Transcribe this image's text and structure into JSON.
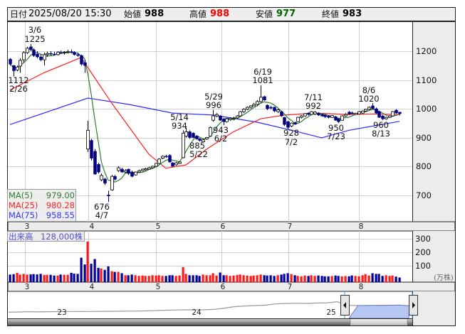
{
  "header": {
    "date_label": "日付",
    "date_value": "2025/08/20 15:30",
    "open_label": "始値",
    "open_value": "988",
    "high_label": "高値",
    "high_value": "988",
    "low_label": "安値",
    "low_value": "977",
    "close_label": "終値",
    "close_value": "983"
  },
  "colors": {
    "up_volume": "#ff1a1a",
    "down_volume": "#000099",
    "down_candle": "#000080",
    "ma5": "#2e7d2e",
    "ma25": "#ff2020",
    "ma75": "#2a2aff",
    "high": "#ff0000",
    "low": "#006600"
  },
  "legend": [
    {
      "name": "MA(5)",
      "value": "979.00"
    },
    {
      "name": "MA(25)",
      "value": "980.28"
    },
    {
      "name": "MA(75)",
      "value": "958.55"
    }
  ],
  "volume_label": {
    "name": "出来高",
    "value": "128,000株"
  },
  "months": [
    "3",
    "4",
    "5",
    "6",
    "7",
    "8"
  ],
  "price_ticks": [
    "1200",
    "1100",
    "1000",
    "900",
    "800",
    "700"
  ],
  "volume_ticks": [
    "300",
    "200",
    "100"
  ],
  "volume_unit": "(万株)",
  "annotations": [
    {
      "date": "3/6",
      "price": "1225"
    },
    {
      "date": "2/26",
      "price": "1112"
    },
    {
      "date": "4/7",
      "price": "676"
    },
    {
      "date": "5/14",
      "price": "934"
    },
    {
      "date": "5/22",
      "price": "885"
    },
    {
      "date": "5/29",
      "price": "996"
    },
    {
      "date": "6/2",
      "price": "943"
    },
    {
      "date": "6/19",
      "price": "1081"
    },
    {
      "date": "7/2",
      "price": "928"
    },
    {
      "date": "7/11",
      "price": "992"
    },
    {
      "date": "7/23",
      "price": "950"
    },
    {
      "date": "8/6",
      "price": "1020"
    },
    {
      "date": "8/13",
      "price": "960"
    }
  ],
  "navigator": {
    "year_labels": [
      "23",
      "24",
      "25"
    ],
    "series": [
      690,
      700,
      710,
      705,
      715,
      720,
      725,
      720,
      725,
      730,
      730,
      735,
      740,
      745,
      760,
      780,
      790,
      800,
      800,
      805,
      820,
      880,
      950,
      980,
      1000,
      1020,
      1080,
      1100,
      1110,
      1100,
      1120,
      1130,
      1180,
      1010,
      1000,
      1005,
      1010,
      1015,
      1020,
      990
    ],
    "selected_range": [
      "2025/02/26",
      "2025/08/20"
    ]
  },
  "chart_data": {
    "type": "candlestick",
    "title": "",
    "date_range": [
      "2025/02/26",
      "2025/08/20"
    ],
    "ylabel": "",
    "ylim": [
      640,
      1290
    ],
    "volume_unit": "万株",
    "volume_ylim": [
      0,
      310
    ],
    "candles_ohlc": [
      [
        1172,
        1176,
        1150,
        1155
      ],
      [
        1150,
        1152,
        1112,
        1132
      ],
      [
        1135,
        1150,
        1130,
        1145
      ],
      [
        1148,
        1175,
        1125,
        1168
      ],
      [
        1170,
        1200,
        1160,
        1195
      ],
      [
        1195,
        1215,
        1190,
        1210
      ],
      [
        1215,
        1225,
        1200,
        1205
      ],
      [
        1205,
        1210,
        1180,
        1185
      ],
      [
        1190,
        1200,
        1175,
        1180
      ],
      [
        1180,
        1190,
        1165,
        1170
      ],
      [
        1170,
        1195,
        1150,
        1188
      ],
      [
        1188,
        1198,
        1180,
        1192
      ],
      [
        1192,
        1200,
        1185,
        1190
      ],
      [
        1190,
        1198,
        1185,
        1188
      ],
      [
        1188,
        1200,
        1185,
        1196
      ],
      [
        1196,
        1202,
        1190,
        1195
      ],
      [
        1195,
        1200,
        1188,
        1197
      ],
      [
        1197,
        1205,
        1192,
        1198
      ],
      [
        1198,
        1206,
        1192,
        1196
      ],
      [
        1196,
        1200,
        1185,
        1188
      ],
      [
        1188,
        1195,
        1180,
        1185
      ],
      [
        1185,
        1188,
        1150,
        1155
      ],
      [
        1160,
        1170,
        1125,
        1150
      ],
      [
        860,
        958,
        850,
        925
      ],
      [
        890,
        895,
        820,
        828
      ],
      [
        852,
        860,
        770,
        773
      ],
      [
        807,
        812,
        775,
        780
      ],
      [
        753,
        775,
        748,
        768
      ],
      [
        756,
        760,
        735,
        741
      ],
      [
        700,
        715,
        676,
        697
      ],
      [
        718,
        770,
        715,
        765
      ],
      [
        765,
        770,
        750,
        755
      ],
      [
        785,
        800,
        780,
        795
      ],
      [
        790,
        795,
        778,
        780
      ],
      [
        780,
        790,
        776,
        785
      ],
      [
        790,
        792,
        770,
        775
      ],
      [
        780,
        785,
        762,
        765
      ],
      [
        770,
        782,
        768,
        780
      ],
      [
        780,
        788,
        778,
        785
      ],
      [
        785,
        792,
        782,
        790
      ],
      [
        788,
        795,
        785,
        792
      ],
      [
        790,
        798,
        788,
        795
      ],
      [
        795,
        802,
        792,
        800
      ],
      [
        800,
        812,
        798,
        810
      ],
      [
        810,
        828,
        808,
        825
      ],
      [
        828,
        838,
        825,
        835
      ],
      [
        835,
        840,
        830,
        833
      ],
      [
        838,
        842,
        812,
        815
      ],
      [
        812,
        815,
        798,
        800
      ],
      [
        805,
        815,
        802,
        812
      ],
      [
        810,
        818,
        808,
        815
      ],
      [
        830,
        925,
        828,
        915
      ],
      [
        905,
        934,
        900,
        920
      ],
      [
        920,
        925,
        895,
        900
      ],
      [
        915,
        918,
        898,
        900
      ],
      [
        905,
        908,
        892,
        895
      ],
      [
        895,
        898,
        886,
        890
      ],
      [
        885,
        895,
        885,
        892
      ],
      [
        895,
        902,
        892,
        900
      ],
      [
        905,
        938,
        903,
        935
      ],
      [
        960,
        996,
        955,
        975
      ],
      [
        975,
        985,
        970,
        980
      ],
      [
        975,
        978,
        958,
        960
      ],
      [
        965,
        968,
        943,
        955
      ],
      [
        955,
        968,
        952,
        965
      ],
      [
        962,
        970,
        958,
        966
      ],
      [
        966,
        972,
        960,
        968
      ],
      [
        968,
        978,
        965,
        975
      ],
      [
        975,
        992,
        972,
        990
      ],
      [
        990,
        1002,
        985,
        998
      ],
      [
        998,
        1008,
        995,
        1005
      ],
      [
        1005,
        1012,
        1000,
        1010
      ],
      [
        1010,
        1020,
        1008,
        1015
      ],
      [
        1015,
        1030,
        1010,
        1025
      ],
      [
        1025,
        1081,
        1020,
        1040
      ],
      [
        1042,
        1045,
        1028,
        1030
      ],
      [
        1012,
        1015,
        995,
        1000
      ],
      [
        1005,
        1010,
        998,
        1002
      ],
      [
        1005,
        1008,
        988,
        992
      ],
      [
        990,
        1000,
        985,
        996
      ],
      [
        990,
        993,
        972,
        975
      ],
      [
        970,
        972,
        940,
        945
      ],
      [
        955,
        958,
        928,
        935
      ],
      [
        940,
        952,
        936,
        950
      ],
      [
        952,
        955,
        944,
        946
      ],
      [
        955,
        972,
        953,
        970
      ],
      [
        970,
        978,
        966,
        975
      ],
      [
        975,
        985,
        972,
        983
      ],
      [
        985,
        988,
        976,
        980
      ],
      [
        980,
        992,
        978,
        990
      ],
      [
        982,
        992,
        978,
        988
      ],
      [
        985,
        988,
        975,
        978
      ],
      [
        980,
        983,
        972,
        975
      ],
      [
        978,
        980,
        968,
        972
      ],
      [
        975,
        978,
        966,
        970
      ],
      [
        970,
        978,
        968,
        976
      ],
      [
        972,
        975,
        958,
        960
      ],
      [
        965,
        968,
        950,
        955
      ],
      [
        960,
        978,
        958,
        975
      ],
      [
        975,
        985,
        972,
        980
      ],
      [
        988,
        992,
        978,
        982
      ],
      [
        986,
        990,
        980,
        983
      ],
      [
        980,
        986,
        978,
        984
      ],
      [
        982,
        992,
        980,
        990
      ],
      [
        985,
        994,
        982,
        992
      ],
      [
        992,
        1000,
        990,
        998
      ],
      [
        998,
        1008,
        995,
        1005
      ],
      [
        1010,
        1020,
        998,
        1000
      ],
      [
        1000,
        1004,
        982,
        985
      ],
      [
        990,
        992,
        968,
        970
      ],
      [
        975,
        978,
        960,
        965
      ],
      [
        965,
        972,
        962,
        970
      ],
      [
        970,
        978,
        968,
        975
      ],
      [
        975,
        992,
        973,
        990
      ],
      [
        995,
        998,
        983,
        985
      ],
      [
        988,
        988,
        977,
        983
      ]
    ],
    "volume": [
      35,
      38,
      48,
      35,
      40,
      35,
      36,
      38,
      36,
      40,
      32,
      33,
      33,
      28,
      28,
      35,
      33,
      33,
      48,
      42,
      40,
      160,
      110,
      280,
      115,
      150,
      85,
      80,
      70,
      95,
      60,
      55,
      55,
      45,
      30,
      30,
      35,
      30,
      25,
      28,
      25,
      25,
      30,
      28,
      30,
      25,
      25,
      30,
      30,
      25,
      28,
      90,
      40,
      30,
      30,
      30,
      25,
      35,
      30,
      30,
      45,
      28,
      50,
      30,
      30,
      25,
      28,
      32,
      35,
      30,
      28,
      25,
      28,
      30,
      35,
      30,
      28,
      30,
      25,
      30,
      35,
      40,
      45,
      38,
      30,
      25,
      22,
      28,
      25,
      30,
      25,
      28,
      25,
      22,
      22,
      24,
      28,
      25,
      22,
      24,
      22,
      28,
      25,
      22,
      30,
      38,
      28,
      45,
      40,
      40,
      25,
      30,
      25,
      28,
      20,
      13
    ],
    "ma25": [
      [
        0,
        1065
      ],
      [
        10,
        1125
      ],
      [
        21,
        1178
      ],
      [
        30,
        1020
      ],
      [
        41,
        842
      ],
      [
        46,
        793
      ],
      [
        52,
        805
      ],
      [
        58,
        859
      ],
      [
        66,
        920
      ],
      [
        74,
        965
      ],
      [
        81,
        978
      ],
      [
        90,
        985
      ],
      [
        100,
        980
      ],
      [
        107,
        982
      ],
      [
        115,
        980
      ]
    ],
    "ma75": [
      [
        0,
        945
      ],
      [
        23,
        1037
      ],
      [
        35,
        1015
      ],
      [
        48,
        985
      ],
      [
        60,
        978
      ],
      [
        73,
        953
      ],
      [
        85,
        920
      ],
      [
        92,
        899
      ],
      [
        100,
        925
      ],
      [
        115,
        956
      ]
    ]
  }
}
